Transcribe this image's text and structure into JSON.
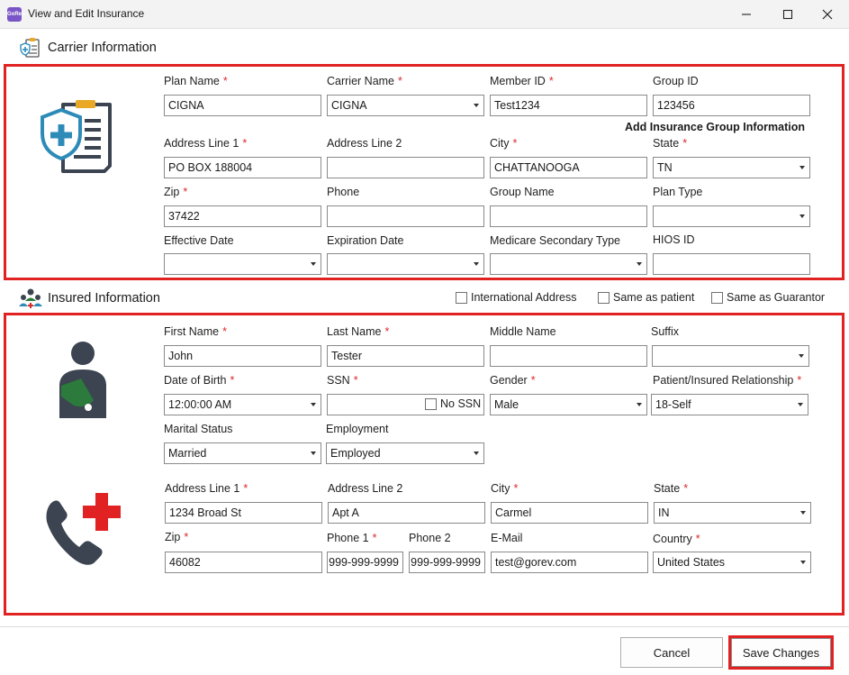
{
  "window": {
    "title": "View and Edit Insurance",
    "app_logo_text": "GoRev"
  },
  "colors": {
    "highlight_red": "#e02222",
    "required_red": "#d92a2a",
    "icon_teal": "#2e8bb8",
    "icon_green": "#2c7a3c"
  },
  "carrier": {
    "header": "Carrier Information",
    "add_group_link": "Add Insurance Group Information",
    "fields": {
      "plan_name": {
        "label": "Plan Name",
        "value": "CIGNA"
      },
      "carrier_name": {
        "label": "Carrier Name",
        "value": "CIGNA"
      },
      "member_id": {
        "label": "Member ID",
        "value": "Test1234"
      },
      "group_id": {
        "label": "Group ID",
        "value": "123456"
      },
      "address1": {
        "label": "Address Line 1",
        "value": "PO BOX 188004"
      },
      "address2": {
        "label": "Address Line 2",
        "value": ""
      },
      "city": {
        "label": "City",
        "value": "CHATTANOOGA"
      },
      "state": {
        "label": "State",
        "value": "TN"
      },
      "zip": {
        "label": "Zip",
        "value": "37422"
      },
      "phone": {
        "label": "Phone",
        "value": ""
      },
      "group_name": {
        "label": "Group Name",
        "value": ""
      },
      "plan_type": {
        "label": "Plan Type",
        "value": ""
      },
      "effective_date": {
        "label": "Effective Date",
        "value": ""
      },
      "expiration_date": {
        "label": "Expiration Date",
        "value": ""
      },
      "medicare_secondary": {
        "label": "Medicare Secondary Type",
        "value": ""
      },
      "hios_id": {
        "label": "HIOS ID",
        "value": ""
      }
    }
  },
  "insured": {
    "header": "Insured Information",
    "checkboxes": {
      "international": "International Address",
      "same_patient": "Same as patient",
      "same_guarantor": "Same as Guarantor"
    },
    "no_ssn_label": "No SSN",
    "fields": {
      "first_name": {
        "label": "First Name",
        "value": "John"
      },
      "last_name": {
        "label": "Last Name",
        "value": "Tester"
      },
      "middle_name": {
        "label": "Middle Name",
        "value": ""
      },
      "suffix": {
        "label": "Suffix",
        "value": ""
      },
      "dob": {
        "label": "Date of Birth",
        "value": "12:00:00 AM"
      },
      "ssn": {
        "label": "SSN",
        "value": ""
      },
      "gender": {
        "label": "Gender",
        "value": "Male"
      },
      "relationship": {
        "label": "Patient/Insured Relationship",
        "value": "18-Self"
      },
      "marital_status": {
        "label": "Marital Status",
        "value": "Married"
      },
      "employment": {
        "label": "Employment",
        "value": "Employed"
      },
      "address1": {
        "label": "Address Line 1",
        "value": "1234 Broad St"
      },
      "address2": {
        "label": "Address Line 2",
        "value": "Apt A"
      },
      "city": {
        "label": "City",
        "value": "Carmel"
      },
      "state": {
        "label": "State",
        "value": "IN"
      },
      "zip": {
        "label": "Zip",
        "value": "46082"
      },
      "phone1": {
        "label": "Phone 1",
        "value": "999-999-9999"
      },
      "phone2": {
        "label": "Phone 2",
        "value": "999-999-9999"
      },
      "email": {
        "label": "E-Mail",
        "value": "test@gorev.com"
      },
      "country": {
        "label": "Country",
        "value": "United States"
      }
    }
  },
  "required_mark": "*",
  "buttons": {
    "cancel": "Cancel",
    "save": "Save Changes"
  },
  "icons": {
    "carrier_header": "insurance-card-icon",
    "carrier_main": "shield-document-icon",
    "insured_header": "people-group-icon",
    "insured_main": "injured-person-icon",
    "contact_main": "phone-medical-cross-icon"
  }
}
